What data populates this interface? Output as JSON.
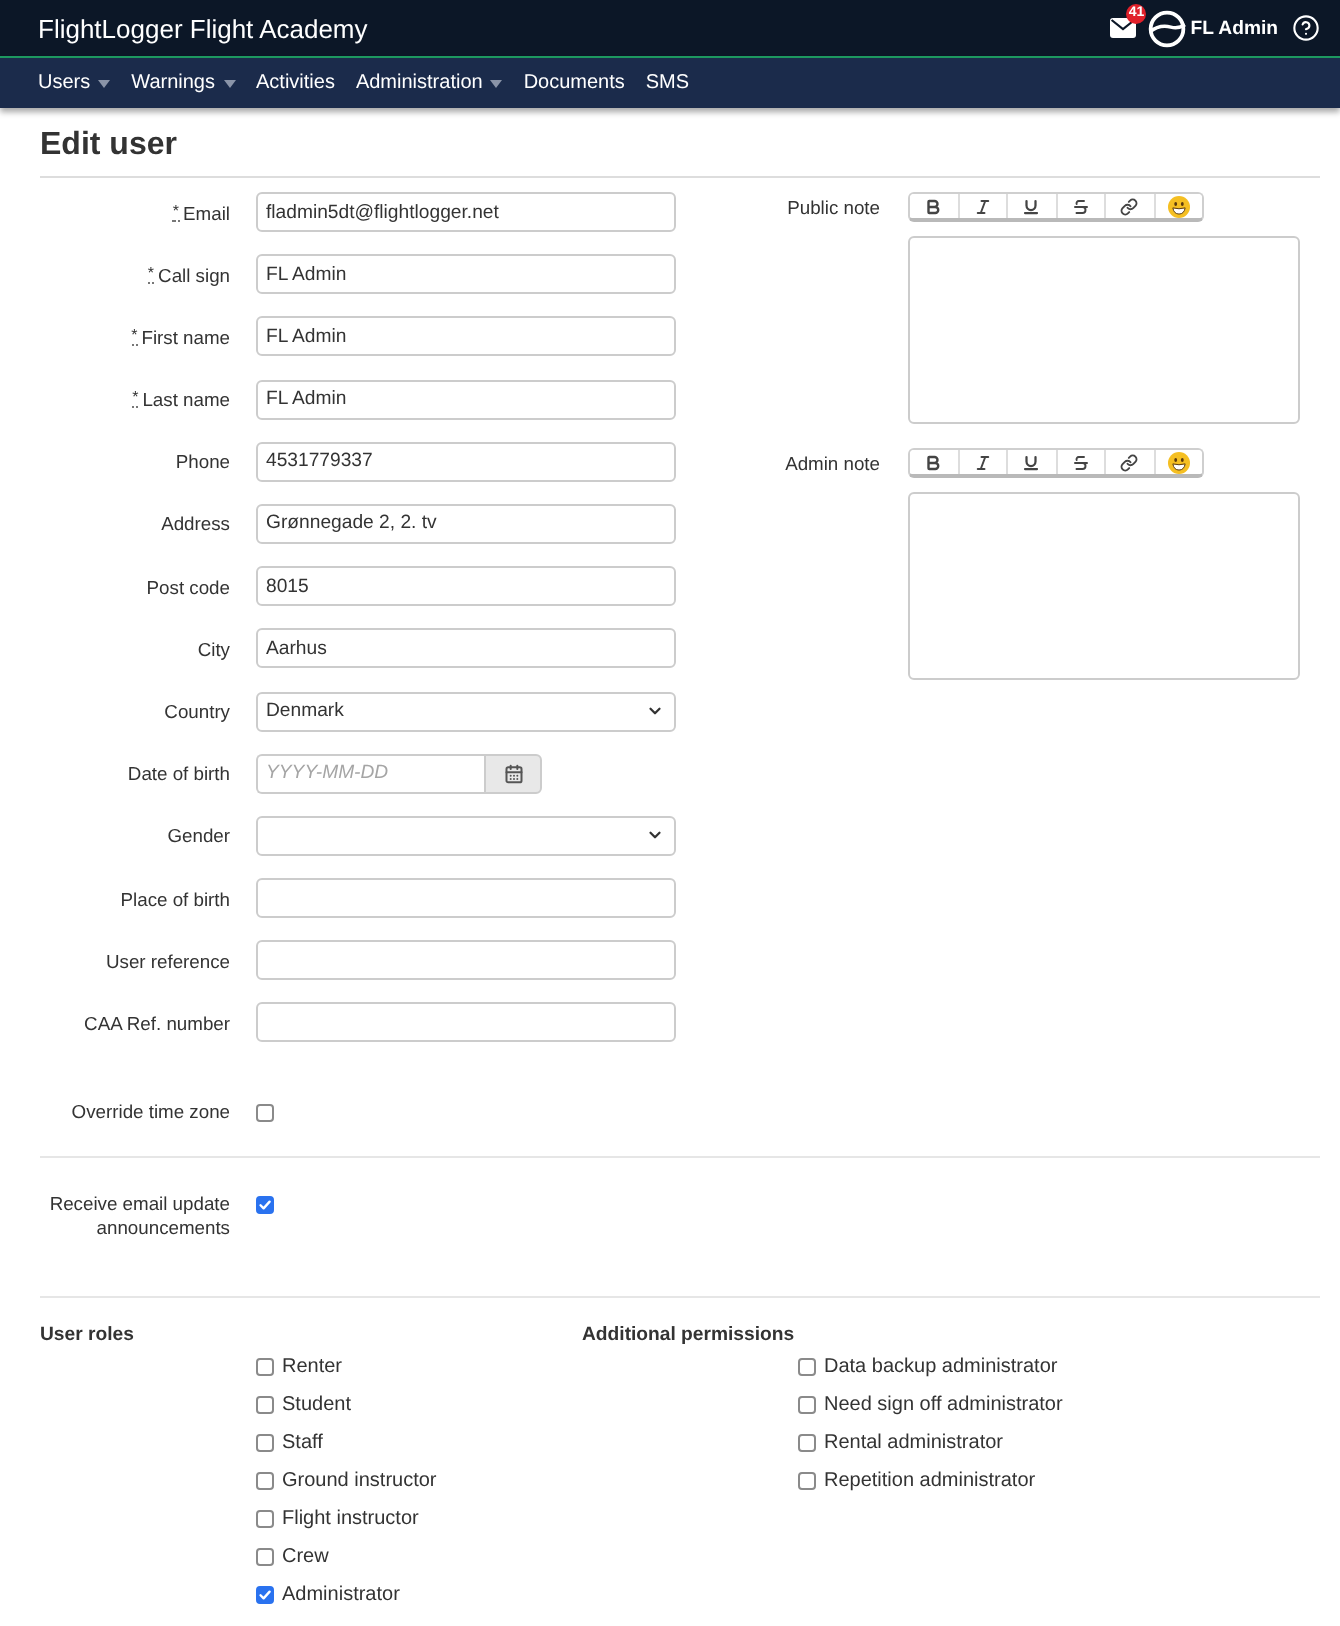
{
  "header": {
    "title": "FlightLogger Flight Academy",
    "unread_count": "41",
    "user_name": "FL Admin"
  },
  "nav": [
    {
      "label": "Users",
      "dropdown": true
    },
    {
      "label": "Warnings",
      "dropdown": true
    },
    {
      "label": "Activities",
      "dropdown": false
    },
    {
      "label": "Administration",
      "dropdown": true
    },
    {
      "label": "Documents",
      "dropdown": false
    },
    {
      "label": "SMS",
      "dropdown": false
    }
  ],
  "page_title": "Edit user",
  "fields": [
    {
      "label": "Email",
      "required_mark": "*",
      "kind": "text",
      "value": "fladmin5dt@flightlogger.net"
    },
    {
      "label": "Call sign",
      "required_mark": "*",
      "kind": "text",
      "value": "FL Admin"
    },
    {
      "label": "First name",
      "required_mark": "*",
      "kind": "text",
      "value": "FL Admin"
    },
    {
      "label": "Last name",
      "required_mark": "*",
      "kind": "text",
      "value": "FL Admin"
    },
    {
      "label": "Phone",
      "kind": "text",
      "value": "4531779337"
    },
    {
      "label": "Address",
      "kind": "text",
      "value": "Grønnegade 2, 2. tv"
    },
    {
      "label": "Post code",
      "kind": "text",
      "value": "8015"
    },
    {
      "label": "City",
      "kind": "text",
      "value": "Aarhus"
    },
    {
      "label": "Country",
      "kind": "select",
      "value": "Denmark"
    },
    {
      "label": "Date of birth",
      "kind": "date",
      "placeholder": "YYYY-MM-DD"
    },
    {
      "label": "Gender",
      "kind": "select"
    },
    {
      "label": "Place of birth",
      "kind": "text"
    },
    {
      "label": "User reference",
      "kind": "text"
    },
    {
      "label": "CAA Ref. number",
      "kind": "text"
    }
  ],
  "notes": [
    {
      "label": "Public note"
    },
    {
      "label": "Admin note"
    }
  ],
  "settings": [
    {
      "label": "Override time zone",
      "checked": false
    },
    {
      "label": "Receive email update announcements",
      "checked": true
    }
  ],
  "user_roles": {
    "title": "User roles",
    "items": [
      {
        "label": "Renter",
        "checked": false
      },
      {
        "label": "Student",
        "checked": false
      },
      {
        "label": "Staff",
        "checked": false
      },
      {
        "label": "Ground instructor",
        "checked": false
      },
      {
        "label": "Flight instructor",
        "checked": false
      },
      {
        "label": "Crew",
        "checked": false
      },
      {
        "label": "Administrator",
        "checked": true
      }
    ]
  },
  "additional_permissions": {
    "title": "Additional permissions",
    "items": [
      {
        "label": "Data backup administrator",
        "checked": false
      },
      {
        "label": "Need sign off administrator",
        "checked": false
      },
      {
        "label": "Rental administrator",
        "checked": false
      },
      {
        "label": "Repetition administrator",
        "checked": false
      }
    ]
  }
}
